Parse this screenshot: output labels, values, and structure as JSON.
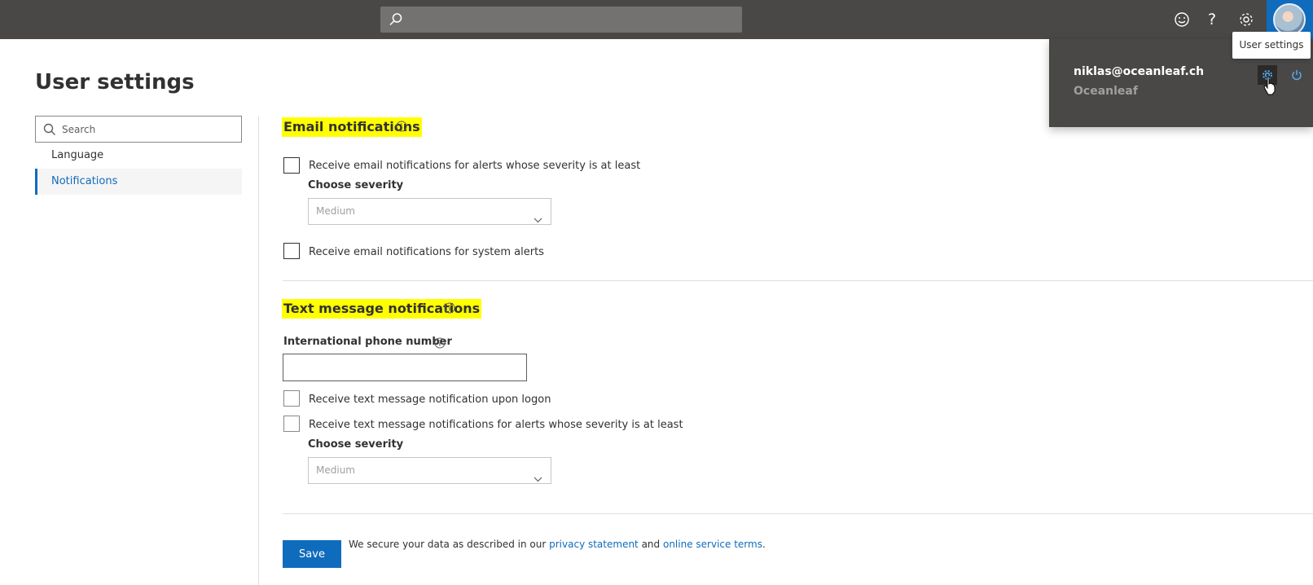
{
  "topbar": {
    "search_placeholder": "",
    "icons": [
      "search-icon",
      "smiley-icon",
      "help-icon",
      "gear-icon",
      "avatar"
    ]
  },
  "page": {
    "title": "User settings"
  },
  "sidebar": {
    "search_placeholder": "Search",
    "items": [
      {
        "label": "Language",
        "active": false
      },
      {
        "label": "Notifications",
        "active": true
      }
    ]
  },
  "email_section": {
    "heading": "Email notifications",
    "severity_checkbox_label": "Receive email notifications for alerts whose severity is at least",
    "choose_severity_label": "Choose severity",
    "severity_value": "Medium",
    "system_alerts_label": "Receive email notifications for system alerts"
  },
  "text_section": {
    "heading": "Text message notifications",
    "phone_label": "International phone number",
    "phone_value": "",
    "logon_label": "Receive text message notification upon logon",
    "severity_checkbox_label": "Receive text message notifications for alerts whose severity is at least",
    "choose_severity_label": "Choose severity",
    "severity_value": "Medium"
  },
  "footer": {
    "save_label": "Save",
    "text_before": "We secure your data as described in our ",
    "privacy_link": "privacy statement",
    "text_middle": " and ",
    "terms_link": "online service terms",
    "text_after": "."
  },
  "flyout": {
    "email": "niklas@oceanleaf.ch",
    "org": "Oceanleaf",
    "tooltip": "User settings"
  },
  "colors": {
    "topbar": "#4a4846",
    "accent": "#0f6cbd",
    "highlight": "#ffff00"
  }
}
